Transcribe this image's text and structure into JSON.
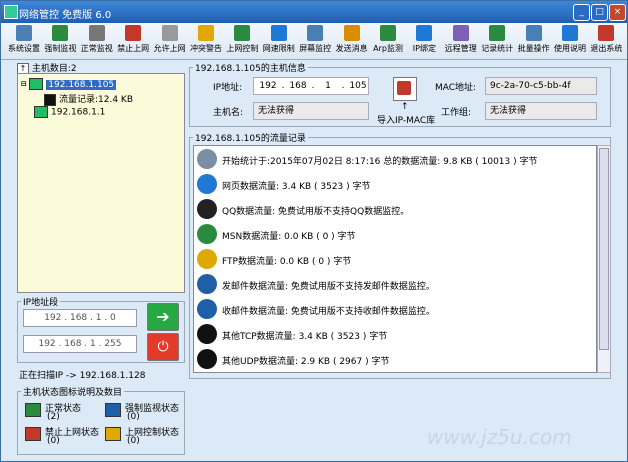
{
  "window": {
    "title": "网络管控 免费版 6.0"
  },
  "titlebar": {
    "minimize": "_",
    "maximize": "□",
    "close": "×"
  },
  "toolbar": [
    {
      "label": "系统设置",
      "icon": "settings-icon",
      "color": "#4a7fb5"
    },
    {
      "label": "强制监视",
      "icon": "monitor-icon",
      "color": "#2b8a3e"
    },
    {
      "label": "正常监视",
      "icon": "display-icon",
      "color": "#777777"
    },
    {
      "label": "禁止上网",
      "icon": "block-icon",
      "color": "#c0392b"
    },
    {
      "label": "允许上网",
      "icon": "allow-icon",
      "color": "#999999"
    },
    {
      "label": "冲突警告",
      "icon": "warning-icon",
      "color": "#e0a800"
    },
    {
      "label": "上网控制",
      "icon": "control-icon",
      "color": "#2b8a3e"
    },
    {
      "label": "网速限制",
      "icon": "speed-icon",
      "color": "#1f78d1"
    },
    {
      "label": "屏幕监控",
      "icon": "screen-icon",
      "color": "#4a7fb5"
    },
    {
      "label": "发送消息",
      "icon": "message-icon",
      "color": "#d98c00"
    },
    {
      "label": "Arp监测",
      "icon": "arp-icon",
      "color": "#2b8a3e"
    },
    {
      "label": "IP绑定",
      "icon": "ipbind-icon",
      "color": "#1f78d1"
    },
    {
      "label": "远程管理",
      "icon": "remote-icon",
      "color": "#7d5fb5"
    },
    {
      "label": "记录统计",
      "icon": "record-icon",
      "color": "#2b8a3e"
    },
    {
      "label": "批量操作",
      "icon": "batch-icon",
      "color": "#4a7fb5"
    },
    {
      "label": "使用说明",
      "icon": "help-icon",
      "color": "#1f78d1"
    },
    {
      "label": "退出系统",
      "icon": "exit-icon",
      "color": "#c0392b"
    }
  ],
  "hosts": {
    "count_label": "主机数目:2",
    "items": [
      {
        "ip": "192.168.1.105",
        "selected": true
      },
      {
        "child": "流量记录:12.4 KB"
      },
      {
        "ip": "192.168.1.1"
      }
    ]
  },
  "ip_range": {
    "legend": "IP地址段",
    "start": "192 . 168 . 1 . 0",
    "end": "192 . 168 . 1 . 255",
    "go_icon": "arrow-right-icon",
    "stop_icon": "power-icon"
  },
  "scan_status": "正在扫描IP -> 192.168.1.128",
  "status_legend": {
    "title": "主机状态图标说明及数目",
    "items": [
      {
        "label": "正常状态",
        "count": "(2)",
        "color": "#2b8a3e"
      },
      {
        "label": "强制监视状态",
        "count": "(0)",
        "color": "#1f5fa8"
      },
      {
        "label": "禁止上网状态",
        "count": "(0)",
        "color": "#c0392b"
      },
      {
        "label": "上网控制状态",
        "count": "(0)",
        "color": "#e0a800"
      }
    ]
  },
  "host_info": {
    "legend": "192.168.1.105的主机信息",
    "ip_label": "IP地址:",
    "ip_parts": [
      "192",
      ".",
      "168",
      ".",
      "1",
      ".",
      "105"
    ],
    "hostname_label": "主机名:",
    "hostname": "无法获得",
    "mac_label": "MAC地址:",
    "mac": "9c-2a-70-c5-bb-4f",
    "workgroup_label": "工作组:",
    "workgroup": "无法获得",
    "import_label": "导入IP-MAC库"
  },
  "traffic": {
    "legend": "192.168.1.105的流量记录",
    "rows": [
      {
        "icon": "clock-icon",
        "color": "#7a8ea5",
        "text": "开始统计于:2015年07月02日 8:17:16 总的数据流量: 9.8 KB ( 10013 ) 字节"
      },
      {
        "icon": "ie-icon",
        "color": "#1f78d1",
        "text": "网页数据流量: 3.4 KB ( 3523 ) 字节"
      },
      {
        "icon": "qq-icon",
        "color": "#222222",
        "text": "QQ数据流量: 免费试用版不支持QQ数据监控。"
      },
      {
        "icon": "msn-icon",
        "color": "#2b8a3e",
        "text": "MSN数据流量: 0.0 KB ( 0 ) 字节"
      },
      {
        "icon": "ftp-icon",
        "color": "#e0a800",
        "text": "FTP数据流量: 0.0 KB ( 0 ) 字节"
      },
      {
        "icon": "send-mail-icon",
        "color": "#1f5fa8",
        "text": "发邮件数据流量: 免费试用版不支持发邮件数据监控。"
      },
      {
        "icon": "recv-mail-icon",
        "color": "#1f5fa8",
        "text": "收邮件数据流量: 免费试用版不支持收邮件数据监控。"
      },
      {
        "icon": "tcp-icon",
        "color": "#111111",
        "text": "其他TCP数据流量: 3.4 KB ( 3523 ) 字节"
      },
      {
        "icon": "udp-icon",
        "color": "#111111",
        "text": "其他UDP数据流量: 2.9 KB ( 2967 ) 字节"
      }
    ]
  },
  "watermark": "www.jz5u.com"
}
